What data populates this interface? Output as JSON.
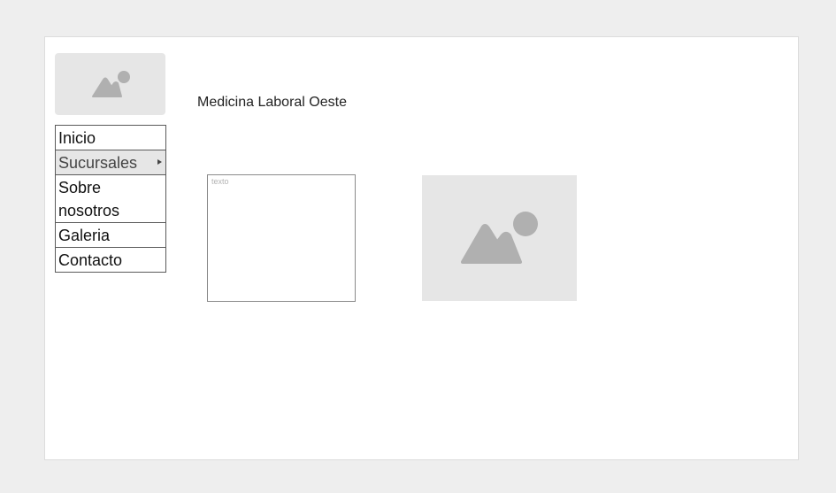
{
  "header": {
    "logo_icon": "image-placeholder-icon",
    "site_title": "Medicina Laboral Oeste"
  },
  "nav": {
    "items": [
      {
        "label": "Inicio",
        "active": false
      },
      {
        "label": "Sucursales",
        "active": true,
        "has_submenu": true
      },
      {
        "label": "Sobre nosotros",
        "active": false
      },
      {
        "label": "Galeria",
        "active": false
      },
      {
        "label": "Contacto",
        "active": false
      }
    ]
  },
  "content": {
    "text_box_label": "texto",
    "image_icon": "image-placeholder-icon"
  },
  "colors": {
    "page_bg": "#eeeeee",
    "canvas_bg": "#ffffff",
    "placeholder_bg": "#e6e6e6",
    "placeholder_icon": "#b0b0b0",
    "active_item_bg": "#e6e6e6"
  }
}
